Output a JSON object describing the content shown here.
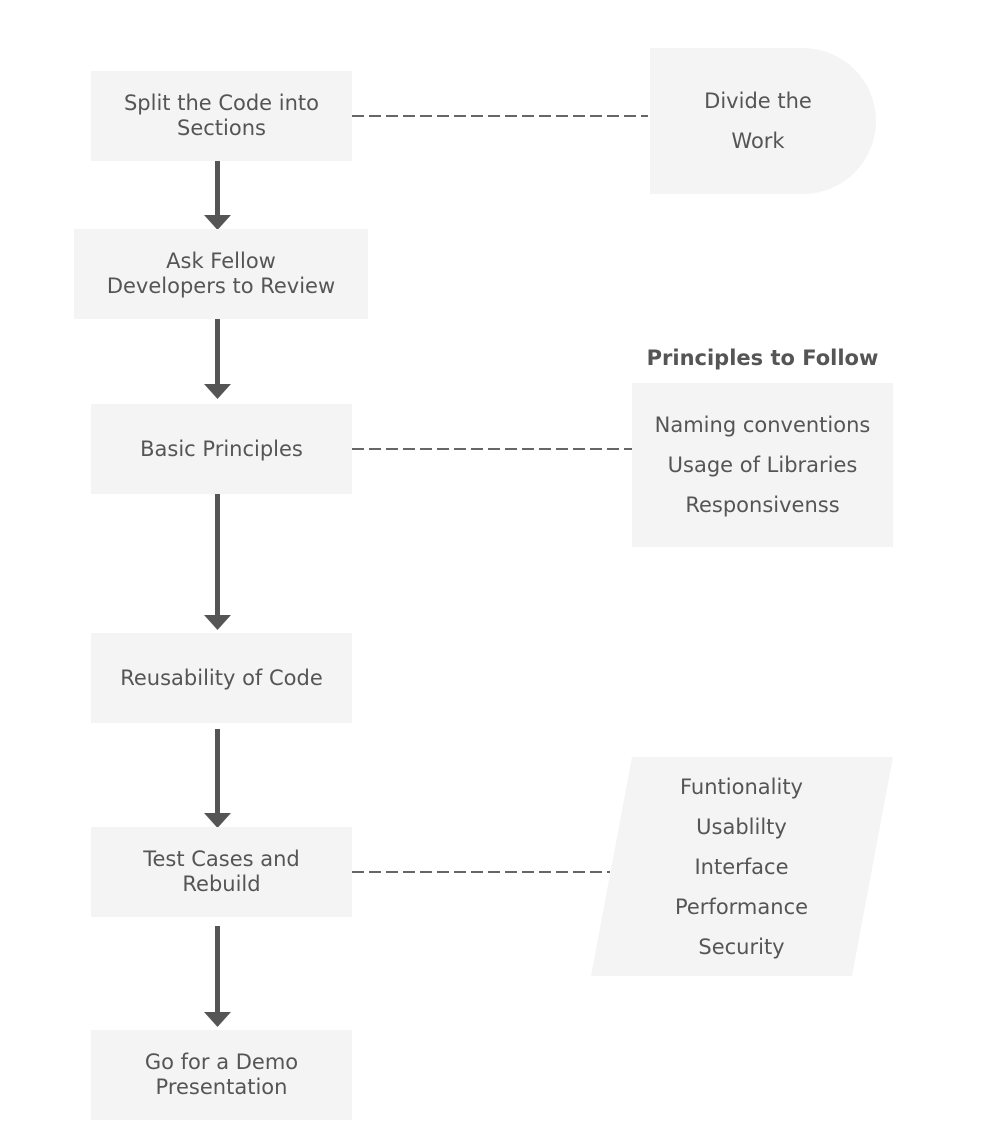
{
  "colors": {
    "node_fill": "#f4f4f4",
    "text": "#555555",
    "connector": "#555555"
  },
  "flow": [
    {
      "id": "split-code",
      "lines": [
        "Split the Code into",
        "Sections"
      ]
    },
    {
      "id": "ask-review",
      "lines": [
        "Ask Fellow",
        "Developers to Review"
      ]
    },
    {
      "id": "basic-principles",
      "lines": [
        "Basic Principles"
      ]
    },
    {
      "id": "reusability",
      "lines": [
        "Reusability of Code"
      ]
    },
    {
      "id": "test-cases",
      "lines": [
        "Test Cases and",
        "Rebuild"
      ]
    },
    {
      "id": "demo",
      "lines": [
        "Go for a Demo",
        "Presentation"
      ]
    }
  ],
  "side_notes": {
    "divide_work": {
      "lines": [
        "Divide the",
        "Work"
      ],
      "linked_to": "split-code"
    },
    "principles": {
      "heading": "Principles to Follow",
      "lines": [
        "Naming conventions",
        "Usage of Libraries",
        "Responsivenss"
      ],
      "linked_to": "basic-principles"
    },
    "testing": {
      "lines": [
        "Funtionality",
        "Usablilty",
        "Interface",
        "Performance",
        "Security"
      ],
      "linked_to": "test-cases"
    }
  }
}
